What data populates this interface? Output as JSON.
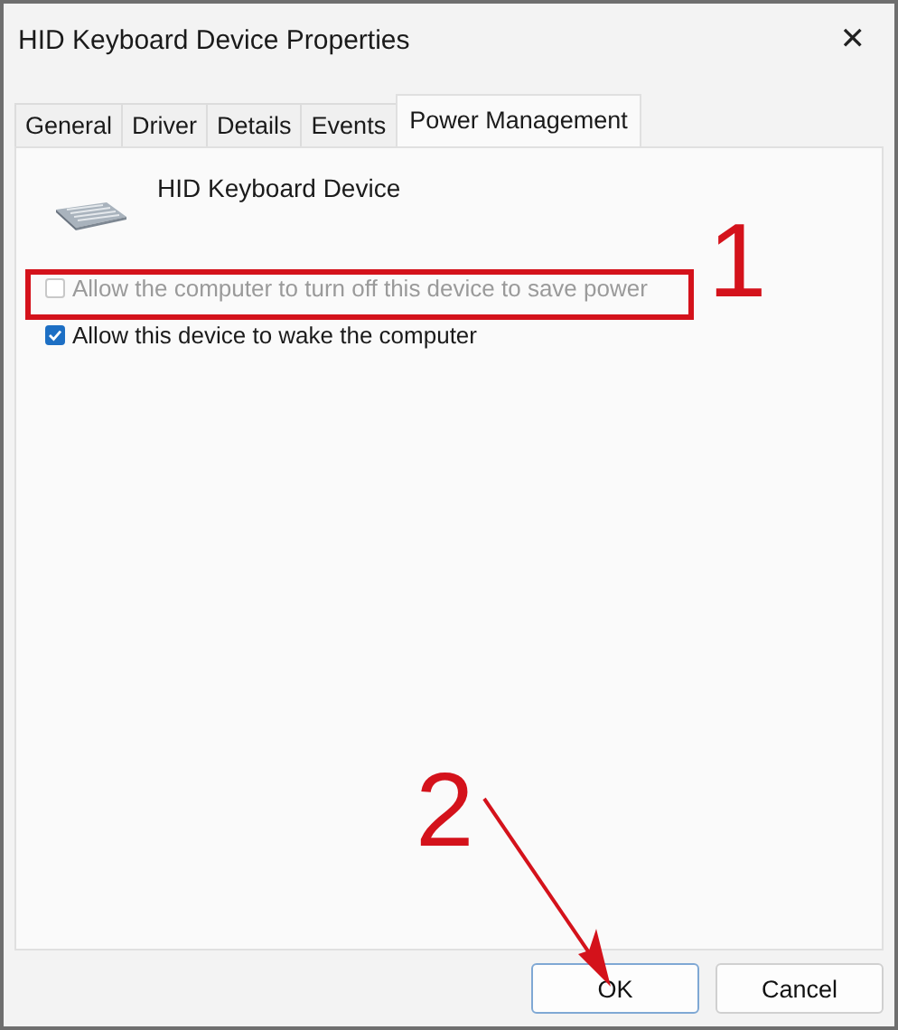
{
  "window": {
    "title": "HID Keyboard Device Properties",
    "close": "✕"
  },
  "tabs": [
    {
      "label": "General",
      "selected": false
    },
    {
      "label": "Driver",
      "selected": false
    },
    {
      "label": "Details",
      "selected": false
    },
    {
      "label": "Events",
      "selected": false
    },
    {
      "label": "Power Management",
      "selected": true
    }
  ],
  "device": {
    "name": "HID Keyboard Device"
  },
  "options": [
    {
      "label": "Allow the computer to turn off this device to save power",
      "checked": false,
      "disabled": true
    },
    {
      "label": "Allow this device to wake the computer",
      "checked": true,
      "disabled": false
    }
  ],
  "buttons": [
    {
      "label": "OK",
      "default": true
    },
    {
      "label": "Cancel",
      "default": false
    }
  ],
  "annotations": [
    {
      "label": "1"
    },
    {
      "label": "2"
    }
  ]
}
